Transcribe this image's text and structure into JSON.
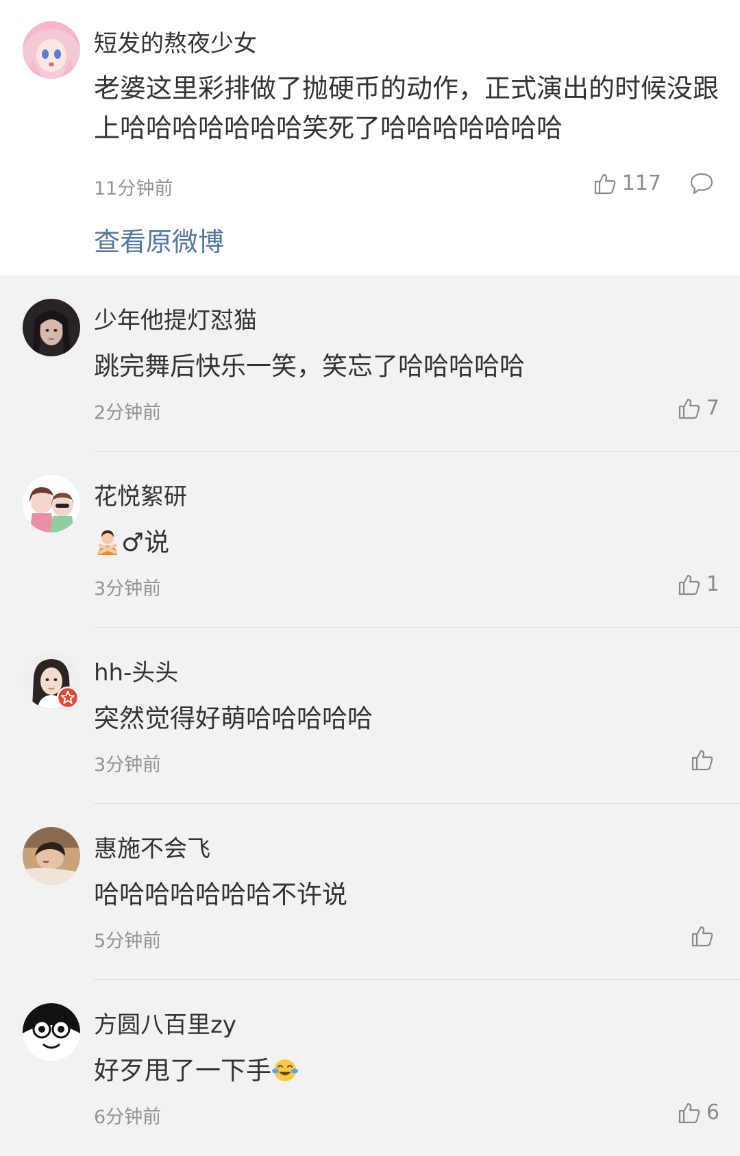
{
  "main_comment": {
    "username": "短发的熬夜少女",
    "text": "老婆这里彩排做了抛硬币的动作，正式演出的时候没跟上哈哈哈哈哈哈哈笑死了哈哈哈哈哈哈哈",
    "time": "11分钟前",
    "likes": "117",
    "view_original_label": "查看原微博"
  },
  "replies": [
    {
      "username": "少年他提灯怼猫",
      "text": "跳完舞后快乐一笑，笑忘了哈哈哈哈哈",
      "time": "2分钟前",
      "likes": "7"
    },
    {
      "username": "花悦絮研",
      "text": "♂说",
      "emoji": "person-gesturing-no-emoji",
      "time": "3分钟前",
      "likes": "1"
    },
    {
      "username": "hh-头头",
      "text": "突然觉得好萌哈哈哈哈哈",
      "time": "3分钟前",
      "likes": ""
    },
    {
      "username": "惠施不会飞",
      "text": "哈哈哈哈哈哈哈不许说",
      "time": "5分钟前",
      "likes": ""
    },
    {
      "username": "方圆八百里zy",
      "text": "好歹甩了一下手",
      "emoji": "laughing-crying-emoji",
      "time": "6分钟前",
      "likes": "6"
    }
  ],
  "colors": {
    "link": "#53779f",
    "text": "#333333",
    "muted": "#939393",
    "background": "#f2f2f2",
    "card": "#ffffff"
  }
}
